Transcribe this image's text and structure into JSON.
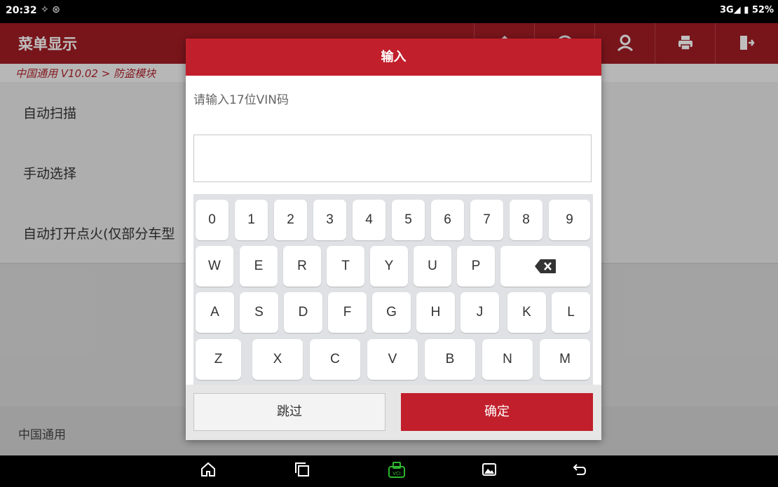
{
  "status": {
    "time": "20:32",
    "left_icons": "✧ ⊛",
    "right": "3G◢ ▮ 52%"
  },
  "header": {
    "title": "菜单显示",
    "buttons": [
      "home-icon",
      "gauge-icon",
      "user-icon",
      "print-icon",
      "exit-icon"
    ]
  },
  "breadcrumb": "中国通用 V10.02 > 防盗模块",
  "menu": [
    {
      "label": "自动扫描"
    },
    {
      "label": "手动选择"
    },
    {
      "label": "自动打开点火(仅部分车型"
    }
  ],
  "footer": {
    "label": "中国通用"
  },
  "dialog": {
    "title": "输入",
    "prompt": "请输入17位VIN码",
    "input_value": "",
    "skip_label": "跳过",
    "ok_label": "确定"
  },
  "keyboard": {
    "row1": [
      "0",
      "1",
      "2",
      "3",
      "4",
      "5",
      "6",
      "7",
      "8",
      "9"
    ],
    "row2": [
      "W",
      "E",
      "R",
      "T",
      "Y",
      "U",
      "P"
    ],
    "row3": [
      "A",
      "S",
      "D",
      "F",
      "G",
      "H",
      "J",
      "K",
      "L"
    ],
    "row4": [
      "Z",
      "X",
      "C",
      "V",
      "B",
      "N",
      "M"
    ],
    "backspace_icon": "backspace-icon"
  },
  "navbar": [
    "home-icon",
    "recent-apps-icon",
    "vci-icon",
    "gallery-icon",
    "back-icon"
  ],
  "colors": {
    "brand_red": "#a01c24",
    "dialog_red": "#c11f2b",
    "vci_green": "#2eb82e"
  }
}
